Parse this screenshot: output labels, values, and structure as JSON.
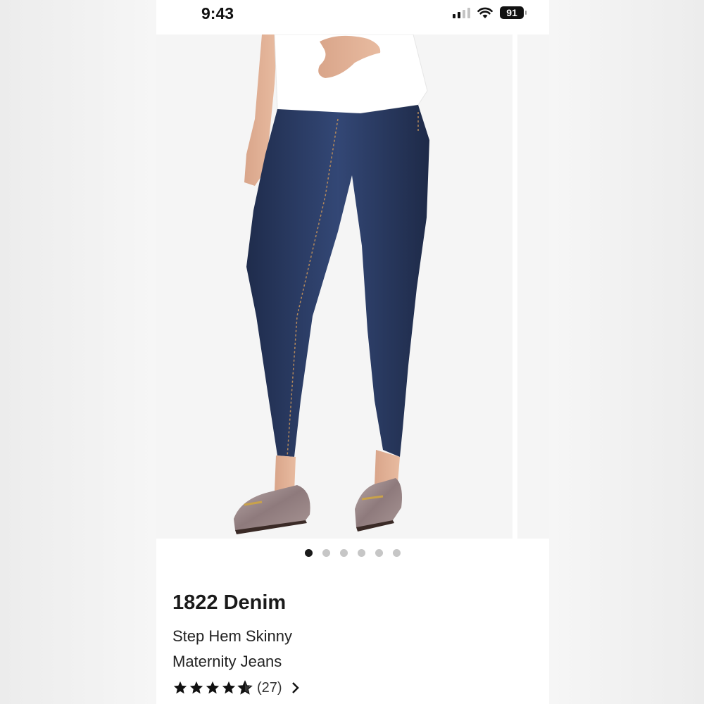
{
  "status_bar": {
    "time": "9:43",
    "battery": "91",
    "icons": [
      "cellular-signal-icon",
      "wifi-icon",
      "battery-icon"
    ]
  },
  "gallery": {
    "image_count": 6,
    "active_index": 0,
    "image_description_icon": "product-photo"
  },
  "product": {
    "brand": "1822 Denim",
    "name_line1": "Step Hem Skinny",
    "name_line2": "Maternity Jeans",
    "rating_value": 4.5,
    "review_count": "(27)"
  },
  "colors": {
    "denim": "#2a3a5e",
    "shirt": "#ffffff",
    "active_dot": "#1a1a1a",
    "inactive_dot": "#c6c6c6"
  }
}
